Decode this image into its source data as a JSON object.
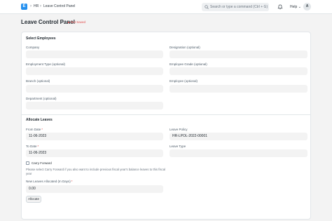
{
  "navbar": {
    "logo": "E",
    "breadcrumbs": [
      "HR",
      "Leave Control Panel"
    ],
    "separator": "›",
    "search_placeholder": "Search or type a command (Ctrl + G)",
    "help_label": "Help",
    "help_chevron": "⌄",
    "avatar_initial": "A",
    "icons": {
      "search": "search-icon",
      "notifications": "bell-icon"
    }
  },
  "page": {
    "title": "Leave Control Panel",
    "status": "Not Saved",
    "status_color": "#e24c4c"
  },
  "select_employees": {
    "heading": "Select Employees",
    "fields": {
      "company": {
        "label": "Company",
        "value": ""
      },
      "designation": {
        "label": "Designation (optional)",
        "value": ""
      },
      "employment_type": {
        "label": "Employment Type (optional)",
        "value": ""
      },
      "employee_grade": {
        "label": "Employee Grade (optional)",
        "value": ""
      },
      "branch": {
        "label": "Branch (optional)",
        "value": ""
      },
      "employee": {
        "label": "Employee (optional)",
        "value": ""
      },
      "department": {
        "label": "Department (optional)",
        "value": ""
      }
    }
  },
  "allocate_leaves": {
    "heading": "Allocate Leaves",
    "required_mark": "*",
    "fields": {
      "from_date": {
        "label": "From Date",
        "value": "11-06-2023"
      },
      "leave_policy": {
        "label": "Leave Policy",
        "value": "HR-LPOL-2022-00001"
      },
      "to_date": {
        "label": "To Date",
        "value": "11-06-2023"
      },
      "leave_type": {
        "label": "Leave Type",
        "value": ""
      },
      "carry_forward": {
        "label": "Carry Forward",
        "checked": false
      },
      "carry_forward_help": "Please select Carry Forward if you also want to include previous fiscal year's balance leaves to this fiscal year",
      "new_leaves_allocated": {
        "label": "New Leaves Allocated (In Days)",
        "value": "0.00"
      }
    },
    "allocate_button": "Allocate"
  },
  "colors": {
    "accent": "#2490ef",
    "required": "#e24c4c",
    "field_bg": "#f3f3f3",
    "page_bg": "#f3f3f3"
  }
}
